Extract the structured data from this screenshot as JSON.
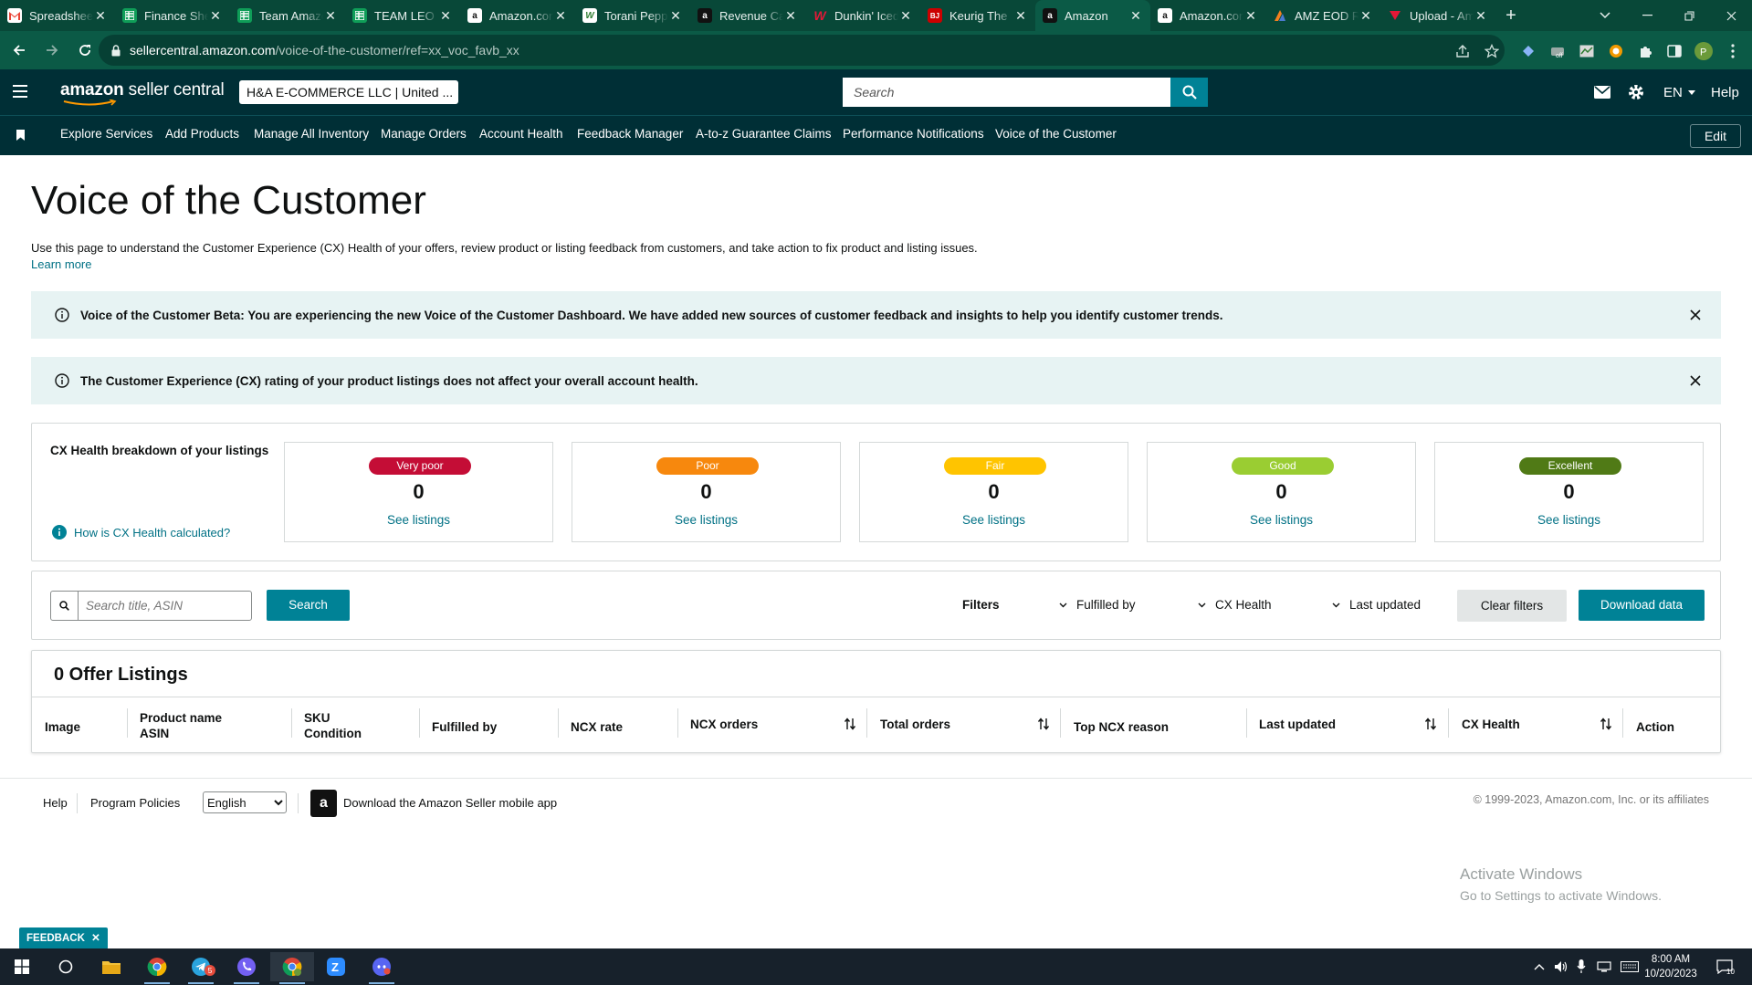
{
  "browser": {
    "tabs": [
      {
        "title": "Spreadsheet",
        "icon": "gmail-icon",
        "color": "#ffffff"
      },
      {
        "title": "Finance Sheet",
        "icon": "sheets-icon",
        "color": "#0f9d58"
      },
      {
        "title": "Team Amazon",
        "icon": "sheets-icon",
        "color": "#0f9d58"
      },
      {
        "title": "TEAM LEO",
        "icon": "sheets-icon",
        "color": "#0f9d58"
      },
      {
        "title": "Amazon.com",
        "icon": "amazon-icon",
        "color": "#ffffff"
      },
      {
        "title": "Torani Peppermint",
        "icon": "torani-icon",
        "color": "#ffffff"
      },
      {
        "title": "Revenue Calculator",
        "icon": "amazon-icon",
        "color": "#111111"
      },
      {
        "title": "Dunkin' Iced",
        "icon": "walgreens-icon",
        "color": "#e31837"
      },
      {
        "title": "Keurig The",
        "icon": "bjs-icon",
        "color": "#cc0000"
      },
      {
        "title": "Amazon",
        "icon": "amazon-icon",
        "color": "#111111"
      },
      {
        "title": "Amazon.com",
        "icon": "amazon-icon",
        "color": "#ffffff"
      },
      {
        "title": "AMZ EOD Report",
        "icon": "amz-eod-icon",
        "color": "#f4801f"
      },
      {
        "title": "Upload - Amazon",
        "icon": "upload-icon",
        "color": "#e31837"
      }
    ],
    "active_tab": 9,
    "url_host": "sellercentral.amazon.com",
    "url_path": "/voice-of-the-customer/ref=xx_voc_favb_xx"
  },
  "header": {
    "logo_main": "amazon",
    "logo_sub": "seller central",
    "account": "H&A E-COMMERCE LLC | United ...",
    "search_placeholder": "Search",
    "language": "EN",
    "help": "Help"
  },
  "nav": {
    "items": [
      "Explore Services",
      "Add Products",
      "Manage All Inventory",
      "Manage Orders",
      "Account Health",
      "Feedback Manager",
      "A-to-z Guarantee Claims",
      "Performance Notifications",
      "Voice of the Customer"
    ],
    "edit": "Edit"
  },
  "page": {
    "title": "Voice of the Customer",
    "intro": "Use this page to understand the Customer Experience (CX) Health of your offers, review product or listing feedback from customers, and take action to fix product and listing issues.",
    "learn_more": "Learn more"
  },
  "banners": [
    "Voice of the Customer Beta: You are experiencing the new Voice of the Customer Dashboard. We have added new sources of customer feedback and insights to help you identify customer trends.",
    "The Customer Experience (CX) rating of your product listings does not affect your overall account health."
  ],
  "cx_health": {
    "label": "CX Health breakdown of your listings",
    "how_link": "How is CX Health calculated?",
    "cards": [
      {
        "label": "Very poor",
        "count": "0",
        "link": "See listings",
        "color": "#c40d36"
      },
      {
        "label": "Poor",
        "count": "0",
        "link": "See listings",
        "color": "#f7880d"
      },
      {
        "label": "Fair",
        "count": "0",
        "link": "See listings",
        "color": "#ffc400"
      },
      {
        "label": "Good",
        "count": "0",
        "link": "See listings",
        "color": "#9acd32"
      },
      {
        "label": "Excellent",
        "count": "0",
        "link": "See listings",
        "color": "#507a16"
      }
    ]
  },
  "filters": {
    "search_placeholder": "Search title, ASIN",
    "search_button": "Search",
    "filters_label": "Filters",
    "fulfilled_by": "Fulfilled by",
    "cx_health": "CX Health",
    "last_updated": "Last updated",
    "clear": "Clear filters",
    "download": "Download data"
  },
  "listings": {
    "title": "0 Offer Listings",
    "columns": {
      "image": "Image",
      "product_name": "Product name",
      "asin": "ASIN",
      "sku": "SKU",
      "condition": "Condition",
      "fulfilled_by": "Fulfilled by",
      "ncx_rate": "NCX rate",
      "ncx_orders": "NCX orders",
      "total_orders": "Total orders",
      "top_ncx_reason": "Top NCX reason",
      "last_updated": "Last updated",
      "cx_health": "CX Health",
      "action": "Action"
    }
  },
  "footer": {
    "help": "Help",
    "policies": "Program Policies",
    "language": "English",
    "app": "Download the Amazon Seller mobile app",
    "copyright": "© 1999-2023, Amazon.com, Inc. or its affiliates"
  },
  "watermark": {
    "line1": "Activate Windows",
    "line2": "Go to Settings to activate Windows."
  },
  "feedback": "FEEDBACK",
  "taskbar": {
    "time": "8:00 AM",
    "date": "10/20/2023",
    "notification_count": "10",
    "telegram_badge": "5"
  }
}
